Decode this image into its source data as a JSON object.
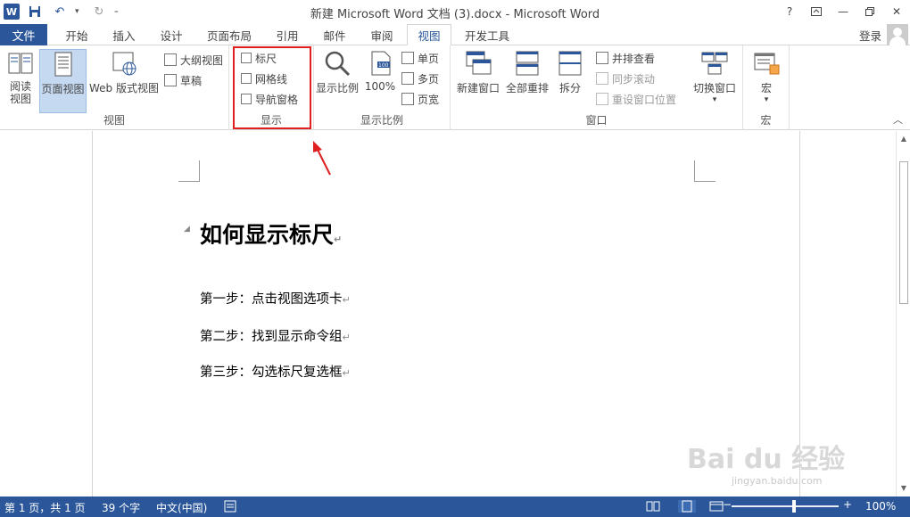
{
  "titlebar": {
    "title": "新建 Microsoft Word 文档 (3).docx - Microsoft Word",
    "logo": "W",
    "help": "?"
  },
  "tabs": {
    "file": "文件",
    "items": [
      "开始",
      "插入",
      "设计",
      "页面布局",
      "引用",
      "邮件",
      "审阅",
      "视图",
      "开发工具"
    ],
    "active": "视图",
    "login": "登录"
  },
  "ribbon": {
    "views": {
      "label": "视图",
      "read_mode": "阅读\n视图",
      "print_layout": "页面视图",
      "web_layout": "Web 版式视图",
      "outline": "大纲视图",
      "draft": "草稿"
    },
    "show": {
      "label": "显示",
      "ruler": "标尺",
      "gridlines": "网格线",
      "nav_pane": "导航窗格"
    },
    "zoom": {
      "label": "显示比例",
      "zoom": "显示比例",
      "hundred": "100%",
      "one_page": "单页",
      "multiple_pages": "多页",
      "page_width": "页宽"
    },
    "window": {
      "label": "窗口",
      "new_window": "新建窗口",
      "arrange_all": "全部重排",
      "split": "拆分",
      "side_by_side": "并排查看",
      "sync_scroll": "同步滚动",
      "reset_position": "重设窗口位置",
      "switch_windows": "切换窗口"
    },
    "macros": {
      "label": "宏",
      "macros": "宏"
    }
  },
  "document": {
    "heading": "如何显示标尺",
    "paragraphs": [
      "第一步：点击视图选项卡",
      "第二步：找到显示命令组",
      "第三步：勾选标尺复选框"
    ],
    "pilcrow": "↵"
  },
  "statusbar": {
    "page": "第 1 页，共 1 页",
    "words": "39 个字",
    "language": "中文(中国)",
    "zoom": "100%",
    "zoom_level": 1.0
  },
  "watermark": {
    "text": "Bai du 经验",
    "url": "jingyan.baidu.com"
  },
  "colors": {
    "accent": "#2b579a",
    "highlight": "#e02020",
    "selected_bg": "#c5d9f1"
  }
}
